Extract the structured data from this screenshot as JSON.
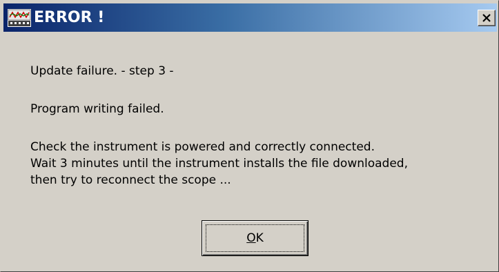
{
  "window": {
    "title": "ERROR !",
    "close_icon": "close-icon",
    "app_icon": "oscilloscope-app-icon"
  },
  "message": {
    "line1": "Update failure. - step 3 -",
    "line2": "Program writing failed.",
    "line3": "Check the instrument is powered and correctly connected.",
    "line4": "Wait 3 minutes until the instrument installs the file downloaded,",
    "line5": "then try to reconnect the scope ..."
  },
  "buttons": {
    "ok_mnemonic": "O",
    "ok_rest": "K"
  },
  "colors": {
    "titlebar_start": "#0a246a",
    "titlebar_end": "#a6caf0",
    "dialog_bg": "#d4d0c8"
  }
}
